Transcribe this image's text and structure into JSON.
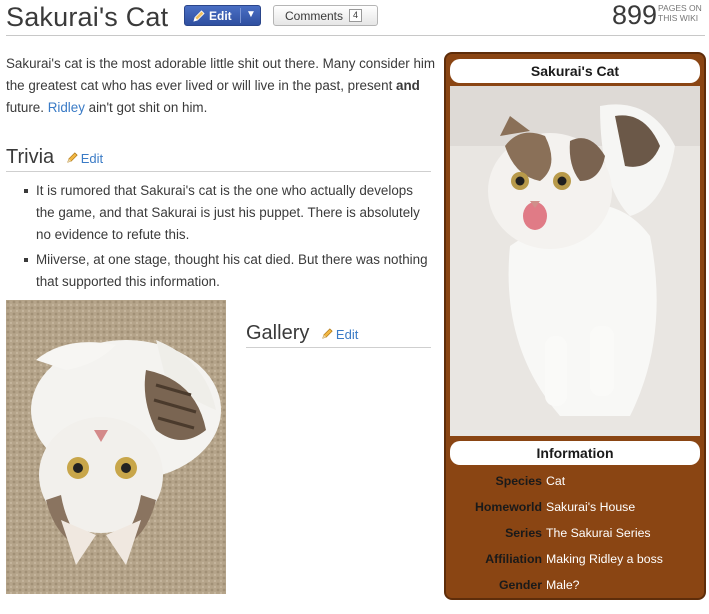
{
  "header": {
    "title": "Sakurai's Cat",
    "edit_label": "Edit",
    "comments_label": "Comments",
    "comments_count": "4",
    "page_count": "899",
    "pages_on_label": "PAGES ON THIS WIKI"
  },
  "intro": {
    "text_1": "Sakurai's cat is the most adorable little shit out there. Many consider him the greatest cat who has ever lived or will live in the past, present ",
    "bold": "and",
    "text_2": " future. ",
    "link": "Ridley",
    "text_3": " ain't got shit on him."
  },
  "trivia": {
    "heading": "Trivia",
    "edit_label": "Edit",
    "items": [
      "It is rumored that Sakurai's cat is the one who actually develops the game, and that Sakurai is just his puppet. There is absolutely no evidence to refute this.",
      "Miiverse, at one stage, thought his cat died. But there was nothing that supported this information."
    ]
  },
  "gallery": {
    "heading": "Gallery",
    "edit_label": "Edit"
  },
  "infobox": {
    "title": "Sakurai's Cat",
    "info_heading": "Information",
    "rows": [
      {
        "key": "Species",
        "value": "Cat"
      },
      {
        "key": "Homeworld",
        "value": "Sakurai's House"
      },
      {
        "key": "Series",
        "value": "The Sakurai Series"
      },
      {
        "key": "Affiliation",
        "value": "Making Ridley a boss"
      },
      {
        "key": "Gender",
        "value": "Male?"
      }
    ]
  },
  "colors": {
    "edit_button": "#3a5bb0",
    "link": "#3a7bc6",
    "infobox_bg": "#8a4513"
  }
}
